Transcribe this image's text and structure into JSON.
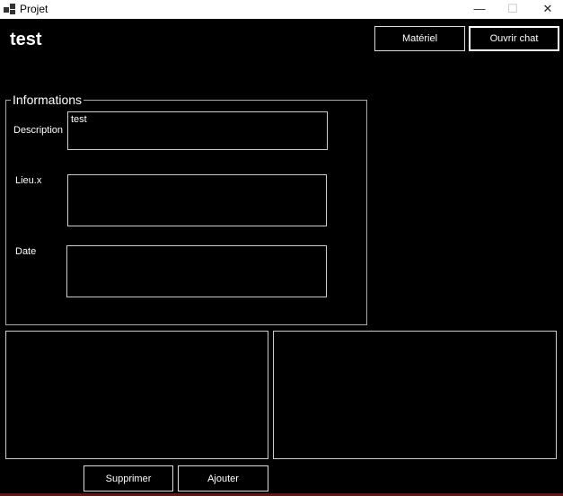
{
  "window": {
    "title": "Projet",
    "minimize_glyph": "—",
    "maximize_glyph": "☐",
    "close_glyph": "✕"
  },
  "header": {
    "title": "test",
    "materiel_label": "Matériel",
    "chat_label": "Ouvrir chat"
  },
  "informations": {
    "legend": "Informations",
    "description_label": "Description",
    "description_value": "test",
    "lieu_label": "Lieu.x",
    "lieu_value": "",
    "date_label": "Date",
    "date_value": ""
  },
  "actions": {
    "delete_label": "Supprimer",
    "add_label": "Ajouter"
  }
}
